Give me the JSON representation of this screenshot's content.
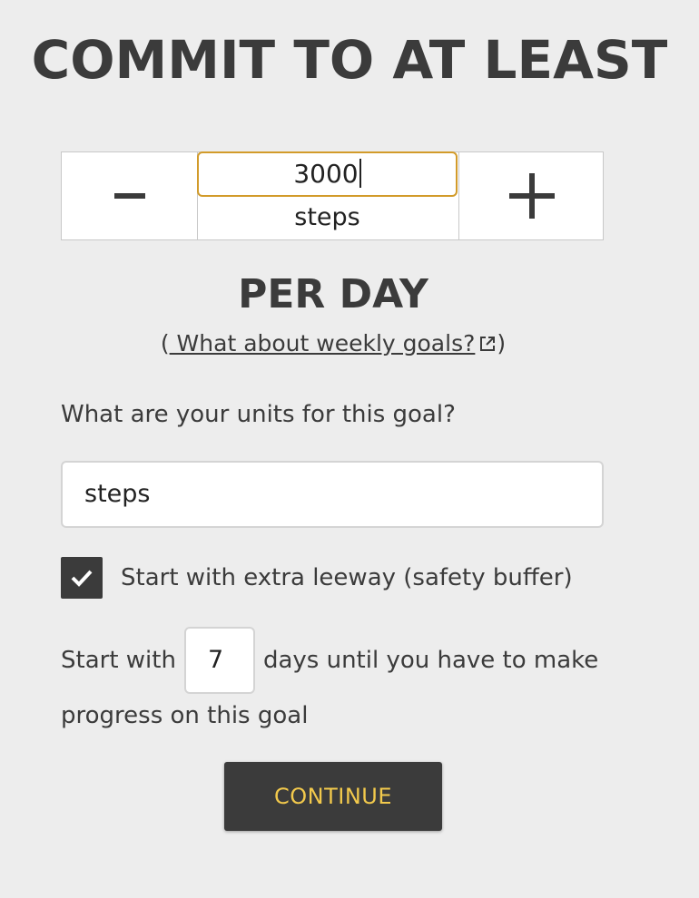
{
  "heading": "COMMIT TO AT LEAST",
  "stepper": {
    "value": "3000",
    "unit": "steps",
    "minus_icon": "minus-icon",
    "plus_icon": "plus-icon"
  },
  "rate": "PER DAY",
  "weekly_link": {
    "open_paren": "(",
    "label": " What about weekly goals?",
    "close_paren": ")",
    "icon": "external-link-icon"
  },
  "units": {
    "question": "What are your units for this goal?",
    "value": "steps"
  },
  "leeway": {
    "checked": true,
    "label": "Start with extra leeway (safety buffer)"
  },
  "buffer": {
    "prefix": "Start with",
    "days": "7",
    "suffix": "days until you have to make",
    "line2": "progress on this goal"
  },
  "continue_label": "CONTINUE",
  "colors": {
    "background": "#ededed",
    "text": "#3b3b3b",
    "focus_border": "#d29b2a",
    "button_bg": "#3b3b3b",
    "button_text": "#f2c94c"
  }
}
